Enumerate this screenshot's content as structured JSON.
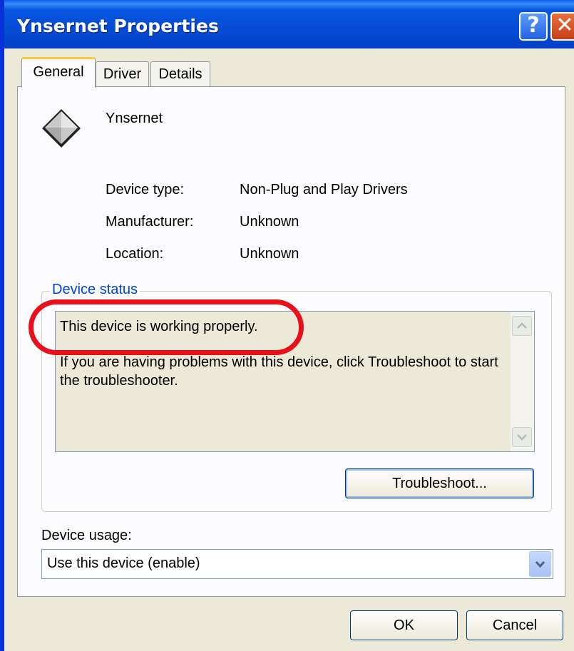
{
  "window": {
    "title": "Ynsernet Properties",
    "help_label": "?",
    "close_label": "✕"
  },
  "tabs": [
    {
      "label": "General",
      "active": true
    },
    {
      "label": "Driver",
      "active": false
    },
    {
      "label": "Details",
      "active": false
    }
  ],
  "device": {
    "name": "Ynsernet",
    "icon": "device-diamond-icon",
    "properties": [
      {
        "label": "Device type:",
        "value": "Non-Plug and Play Drivers"
      },
      {
        "label": "Manufacturer:",
        "value": "Unknown"
      },
      {
        "label": "Location:",
        "value": "Unknown"
      }
    ]
  },
  "status": {
    "legend": "Device status",
    "line1": "This device is working properly.",
    "line2": "If you are having problems with this device, click Troubleshoot to start the troubleshooter.",
    "troubleshoot_label": "Troubleshoot...",
    "highlight_color": "#e8101a"
  },
  "usage": {
    "label": "Device usage:",
    "selected": "Use this device (enable)"
  },
  "buttons": {
    "ok": "OK",
    "cancel": "Cancel"
  },
  "colors": {
    "titlebar": "#0648d2",
    "legend": "#0046d5",
    "dialog_bg": "#ece9d8"
  }
}
